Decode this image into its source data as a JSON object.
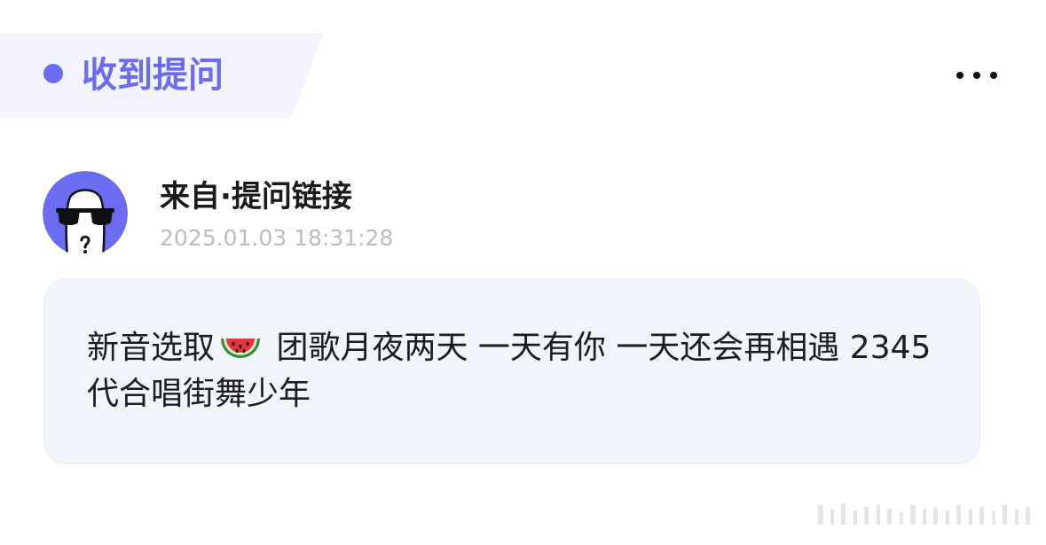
{
  "header": {
    "title": "收到提问",
    "accent_color": "#6c6cf2",
    "more_icon": "more-horizontal-icon"
  },
  "sender": {
    "name": "来自·提问链接",
    "timestamp": "2025.01.03 18:31:28",
    "avatar_icon": "anonymous-sunglasses-avatar"
  },
  "question": {
    "text_before_icon": "新音选取",
    "icon": "watermelon-icon",
    "text_after_icon": " 团歌月夜两天 一天有你 一天还会再相遇 2345代合唱街舞少年"
  },
  "watermark": {
    "icon": "watermark-icon"
  }
}
